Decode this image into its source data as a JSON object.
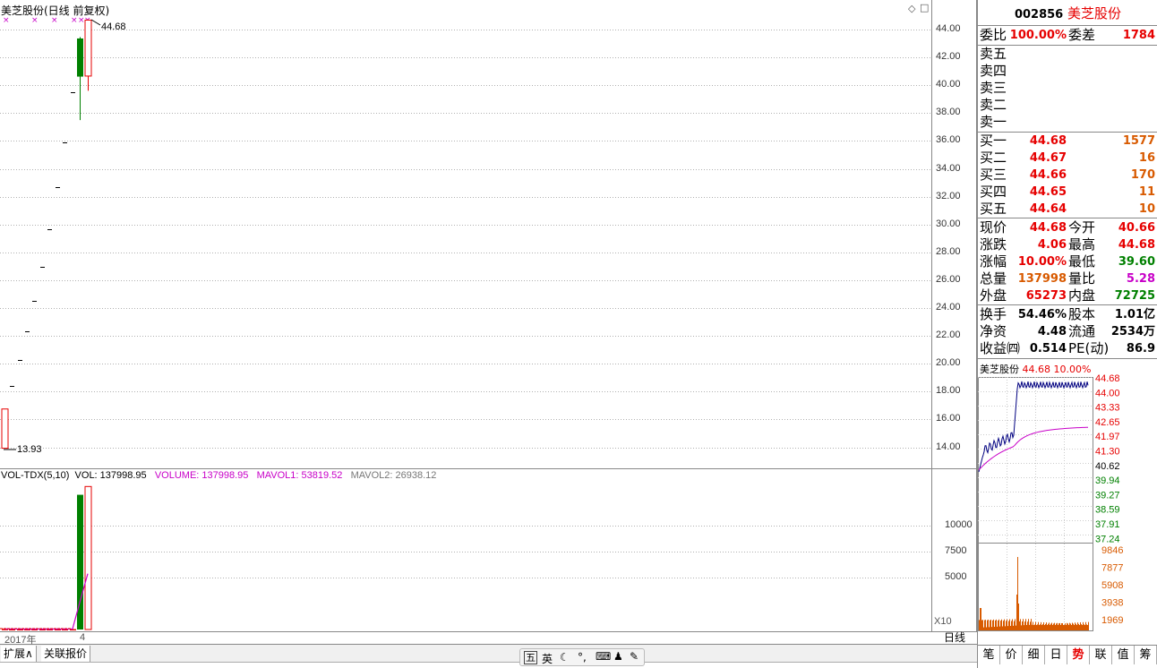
{
  "main": {
    "title": "美芝股份(日线 前复权)",
    "high_label": "44.68",
    "low_label": "13.93",
    "y_ticks": [
      "44.00",
      "42.00",
      "40.00",
      "38.00",
      "36.00",
      "34.00",
      "32.00",
      "30.00",
      "28.00",
      "26.00",
      "24.00",
      "22.00",
      "20.00",
      "18.00",
      "16.00",
      "14.00"
    ],
    "diamond_icon": "◇",
    "close_icon": "□"
  },
  "volume": {
    "indicator_name": "VOL-TDX(5,10)",
    "vol_label": "VOL: 137998.95",
    "volume_label": "VOLUME: 137998.95",
    "mavol1_label": "MAVOL1: 53819.52",
    "mavol2_label": "MAVOL2: 26938.12",
    "y_ticks": [
      "10000",
      "7500",
      "5000"
    ],
    "unit": "X10"
  },
  "date_axis": {
    "year": "2017年",
    "month": "4"
  },
  "period": "日线",
  "bottom_tabs": [
    "扩展∧",
    "关联报价"
  ],
  "quote": {
    "code": "002856",
    "name": "美芝股份",
    "weibi_label": "委比",
    "weibi": "100.00%",
    "weicha_label": "委差",
    "weicha": "1784",
    "sell_labels": [
      "卖五",
      "卖四",
      "卖三",
      "卖二",
      "卖一"
    ],
    "buy": [
      {
        "label": "买一",
        "price": "44.68",
        "vol": "1577"
      },
      {
        "label": "买二",
        "price": "44.67",
        "vol": "16"
      },
      {
        "label": "买三",
        "price": "44.66",
        "vol": "170"
      },
      {
        "label": "买四",
        "price": "44.65",
        "vol": "11"
      },
      {
        "label": "买五",
        "price": "44.64",
        "vol": "10"
      }
    ],
    "stats": [
      {
        "l1": "现价",
        "v1": "44.68",
        "c1": "red",
        "l2": "今开",
        "v2": "40.66",
        "c2": "red"
      },
      {
        "l1": "涨跌",
        "v1": "4.06",
        "c1": "red",
        "l2": "最高",
        "v2": "44.68",
        "c2": "red"
      },
      {
        "l1": "涨幅",
        "v1": "10.00%",
        "c1": "red",
        "l2": "最低",
        "v2": "39.60",
        "c2": "green"
      },
      {
        "l1": "总量",
        "v1": "137998",
        "c1": "orange",
        "l2": "量比",
        "v2": "5.28",
        "c2": "magenta"
      },
      {
        "l1": "外盘",
        "v1": "65273",
        "c1": "red",
        "l2": "内盘",
        "v2": "72725",
        "c2": "green"
      }
    ],
    "fund": [
      {
        "l1": "换手",
        "v1": "54.46%",
        "l2": "股本",
        "v2": "1.01亿"
      },
      {
        "l1": "净资",
        "v1": "4.48",
        "l2": "流通",
        "v2": "2534万"
      },
      {
        "l1": "收益㈣",
        "v1": "0.514",
        "l2": "PE(动)",
        "v2": "86.9"
      }
    ]
  },
  "mini": {
    "name": "美芝股份",
    "price": "44.68",
    "pct": "10.00%",
    "price_ticks": [
      "44.68",
      "44.00",
      "43.33",
      "42.65",
      "41.97",
      "41.30",
      "40.62",
      "39.94",
      "39.27",
      "38.59",
      "37.91",
      "37.24"
    ],
    "vol_ticks": [
      "9846",
      "7877",
      "5908",
      "3938",
      "1969"
    ]
  },
  "right_tabs": [
    "笔",
    "价",
    "细",
    "日",
    "势",
    "联",
    "值",
    "筹"
  ],
  "ime": {
    "mode_icon": "五",
    "lang": "英",
    "moon_icon": "☾",
    "dots": "°,",
    "keyboard_icon": "⌨",
    "user_icon": "♟",
    "wrench_icon": "✎"
  },
  "colors": {
    "up": "#e60000",
    "down": "#008000",
    "ma": "#c800c8",
    "grid": "#b0b0b0"
  },
  "chart_data": {
    "type": "candlestick",
    "title": "美芝股份(日线 前复权)",
    "ylim": [
      13,
      45
    ],
    "candles": [
      {
        "open": 13.93,
        "close": 16.75,
        "high": 16.75,
        "low": 13.93,
        "color": "up"
      },
      {
        "open": 18.43,
        "close": 18.43,
        "high": 18.43,
        "low": 18.43
      },
      {
        "open": 20.27,
        "close": 20.27,
        "high": 20.27,
        "low": 20.27
      },
      {
        "open": 22.3,
        "close": 22.3,
        "high": 22.3,
        "low": 22.3
      },
      {
        "open": 24.53,
        "close": 24.53,
        "high": 24.53,
        "low": 24.53
      },
      {
        "open": 26.98,
        "close": 26.98,
        "high": 26.98,
        "low": 26.98
      },
      {
        "open": 29.68,
        "close": 29.68,
        "high": 29.68,
        "low": 29.68
      },
      {
        "open": 32.65,
        "close": 32.65,
        "high": 32.65,
        "low": 32.65
      },
      {
        "open": 35.92,
        "close": 35.92,
        "high": 35.92,
        "low": 35.92
      },
      {
        "open": 39.51,
        "close": 39.51,
        "high": 39.51,
        "low": 39.51
      },
      {
        "open": 43.36,
        "close": 40.62,
        "high": 43.46,
        "low": 37.5,
        "color": "down"
      },
      {
        "open": 40.66,
        "close": 44.68,
        "high": 44.68,
        "low": 39.6,
        "color": "up"
      }
    ],
    "volume": {
      "ylim": [
        0,
        14000
      ],
      "values": [
        60,
        40,
        40,
        40,
        40,
        40,
        40,
        40,
        40,
        40,
        13000,
        13800
      ],
      "mavol1": [
        60,
        50,
        50,
        45,
        44,
        42,
        42,
        42,
        40,
        60,
        2600,
        5381.952
      ]
    }
  }
}
